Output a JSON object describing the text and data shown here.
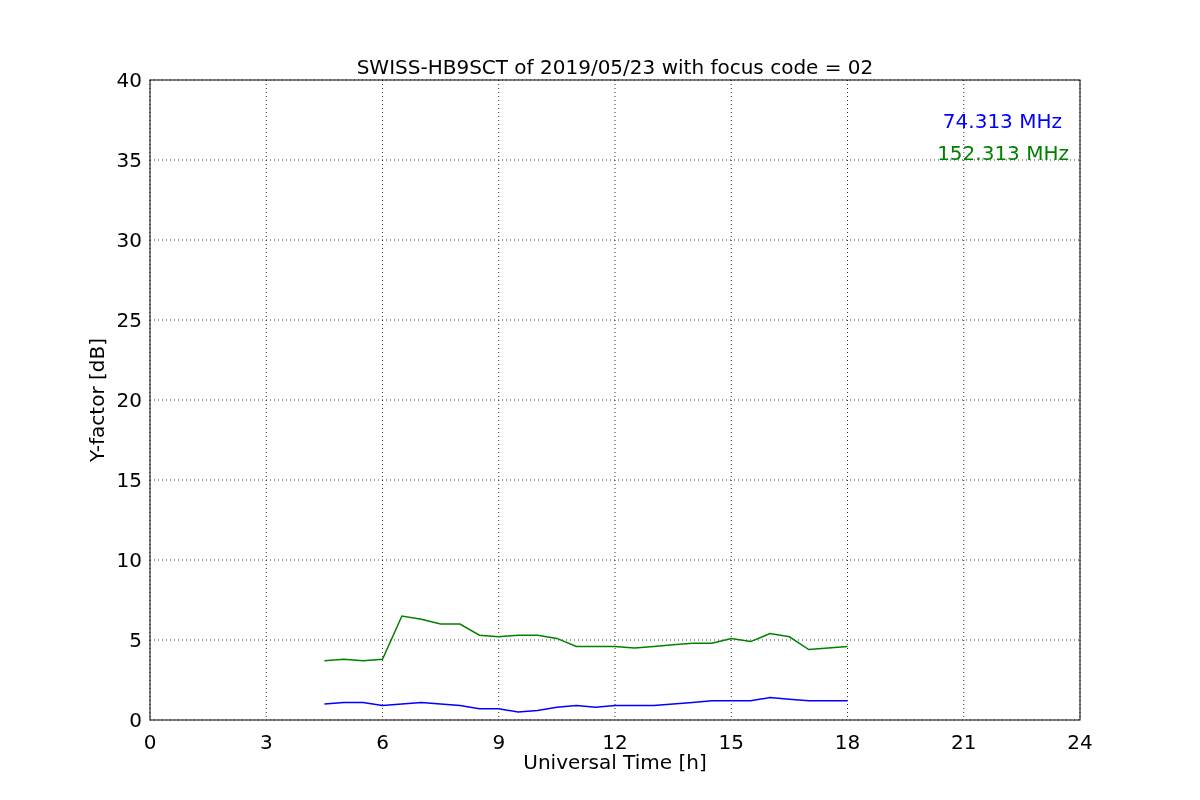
{
  "chart_data": {
    "type": "line",
    "title": "SWISS-HB9SCT of 2019/05/23 with focus code = 02",
    "xlabel": "Universal Time [h]",
    "ylabel": "Y-factor [dB]",
    "x": [
      4.5,
      5,
      5.5,
      6,
      6.5,
      7,
      7.5,
      8,
      8.5,
      9,
      9.5,
      10,
      10.5,
      11,
      11.5,
      12,
      12.5,
      13,
      13.5,
      14,
      14.5,
      15,
      15.5,
      16,
      16.5,
      17,
      17.5,
      18
    ],
    "series": [
      {
        "name": "74.313 MHz",
        "color": "#0000ff",
        "values": [
          1.0,
          1.1,
          1.1,
          0.9,
          1.0,
          1.1,
          1.0,
          0.9,
          0.7,
          0.7,
          0.5,
          0.6,
          0.8,
          0.9,
          0.8,
          0.9,
          0.9,
          0.9,
          1.0,
          1.1,
          1.2,
          1.2,
          1.2,
          1.4,
          1.3,
          1.2,
          1.2,
          1.2
        ]
      },
      {
        "name": "152.313 MHz",
        "color": "#008000",
        "values": [
          3.7,
          3.8,
          3.7,
          3.8,
          6.5,
          6.3,
          6.0,
          6.0,
          5.3,
          5.2,
          5.3,
          5.3,
          5.1,
          4.6,
          4.6,
          4.6,
          4.5,
          4.6,
          4.7,
          4.8,
          4.8,
          5.1,
          4.9,
          5.4,
          5.2,
          4.4,
          4.5,
          4.6
        ]
      }
    ],
    "xlim": [
      0,
      24
    ],
    "ylim": [
      0,
      40
    ],
    "xticks": [
      0,
      3,
      6,
      9,
      12,
      15,
      18,
      21,
      24
    ],
    "yticks": [
      0,
      5,
      10,
      15,
      20,
      25,
      30,
      35,
      40
    ],
    "grid": true
  }
}
